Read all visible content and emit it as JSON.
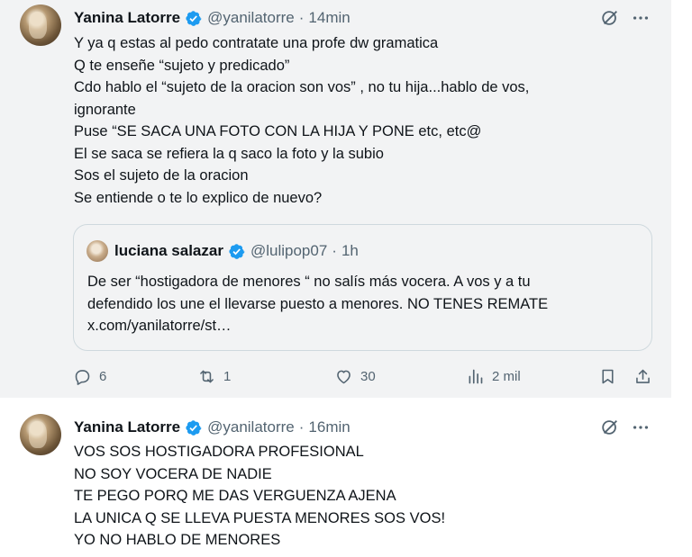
{
  "tweets": [
    {
      "author": "Yanina Latorre",
      "handle": "@yanilatorre",
      "separator": "·",
      "time": "14min",
      "lines": [
        "Y ya q estas al pedo contratate una profe dw gramatica",
        "Q te enseñe “sujeto y predicado”",
        "Cdo hablo el “sujeto de la oracion son vos” , no tu hija...hablo de vos,",
        "ignorante",
        "Puse “SE SACA UNA FOTO CON LA HIJA Y PONE etc, etc@",
        "El se saca se refiera la q saco la foto y la subio",
        "Sos el sujeto de la oracion",
        "Se entiende o te lo explico de nuevo?"
      ],
      "quote": {
        "author": "luciana salazar",
        "handle": "@lulipop07",
        "separator": "·",
        "time": "1h",
        "lines": [
          "De ser “hostigadora de menores “ no salís más  vocera. A vos y a tu",
          "defendido los une el llevarse puesto a menores. NO TENES REMATE",
          "x.com/yanilatorre/st…"
        ]
      },
      "actions": {
        "replies": "6",
        "reposts": "1",
        "likes": "30",
        "views": "2 mil"
      }
    },
    {
      "author": "Yanina Latorre",
      "handle": "@yanilatorre",
      "separator": "·",
      "time": "16min",
      "lines": [
        "VOS SOS HOSTIGADORA PROFESIONAL",
        "NO SOY VOCERA DE NADIE",
        "TE PEGO PORQ ME DAS VERGUENZA AJENA",
        "LA UNICA Q SE LLEVA PUESTA MENORES SOS VOS!",
        "YO NO HABLO DE MENORES"
      ]
    }
  ],
  "colors": {
    "verified": "#1d9bf0",
    "muted_text": "#536471",
    "text": "#0f1419",
    "quote_border": "#cfd9de",
    "tweet_bg": "#f2f3f4"
  },
  "icons": [
    "verified-badge-icon",
    "grok-icon",
    "more-icon",
    "reply-icon",
    "repost-icon",
    "like-icon",
    "views-icon",
    "bookmark-icon",
    "share-icon"
  ]
}
